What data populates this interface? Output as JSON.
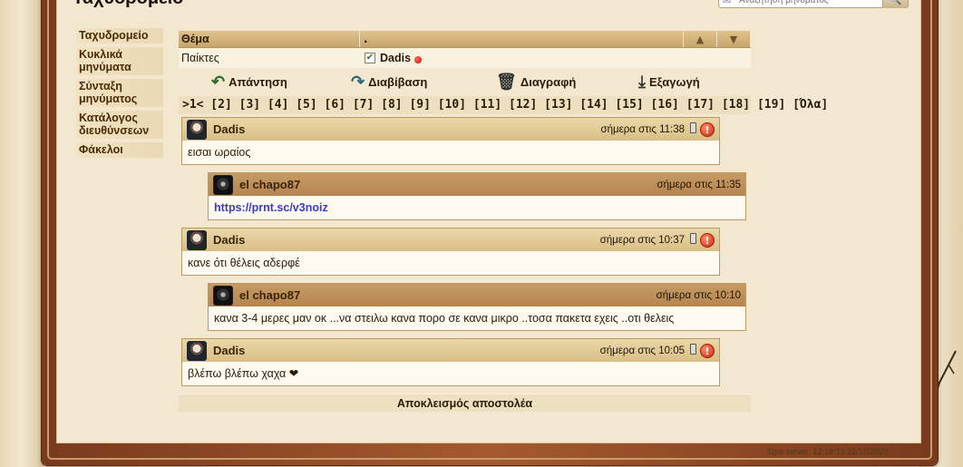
{
  "page": {
    "title": "Ταχυδρομείο"
  },
  "search": {
    "placeholder": "Αναζήτηση μηνύματος"
  },
  "sidebar": {
    "items": [
      {
        "label": "Ταχυδρομείο"
      },
      {
        "label": "Κυκλικά μηνύματα"
      },
      {
        "label": "Σύνταξη μηνύματος"
      },
      {
        "label": "Κατάλογος διευθύνσεων"
      },
      {
        "label": "Φάκελοι"
      }
    ]
  },
  "table": {
    "header_subject": "Θέμα",
    "header_dot": ".",
    "header_up": "▲",
    "header_down": "▼",
    "subject": "Παίκτες",
    "participant": "Dadis"
  },
  "actions": {
    "reply": "Απάντηση",
    "forward": "Διαβίβαση",
    "delete": "Διαγραφή",
    "export": "Εξαγωγή"
  },
  "pagination": ">1< [2] [3] [4] [5] [6] [7] [8] [9] [10] [11] [12] [13] [14] [15] [16] [17] [18] [19] [Όλα]",
  "messages": [
    {
      "author": "Dadis",
      "time": "σήμερα στις 11:38",
      "text": "εισαι ωραίος"
    },
    {
      "author": "el chapo87",
      "time": "σήμερα στις 11:35",
      "text": "https://prnt.sc/v3noiz"
    },
    {
      "author": "Dadis",
      "time": "σήμερα στις 10:37",
      "text": "κανε ότι θέλεις αδερφέ"
    },
    {
      "author": "el chapo87",
      "time": "σήμερα στις 10:10",
      "text": "κανα 3-4 μερες μαν οκ ...να στειλω κανα πορο σε κανα μικρο ..τοσα πακετα εχεις ..οτι θελεις"
    },
    {
      "author": "Dadis",
      "time": "σήμερα στις 10:05",
      "text": "βλέπω βλέπω χαχα ❤"
    }
  ],
  "block_sender": "Αποκλεισμός αποστολέα",
  "server_time": "Ώρα server: 12:18:12 21/10/2020",
  "colors": {
    "header": "#d9bf86",
    "reply_header": "#b5854f",
    "link": "#3a3ad0"
  }
}
